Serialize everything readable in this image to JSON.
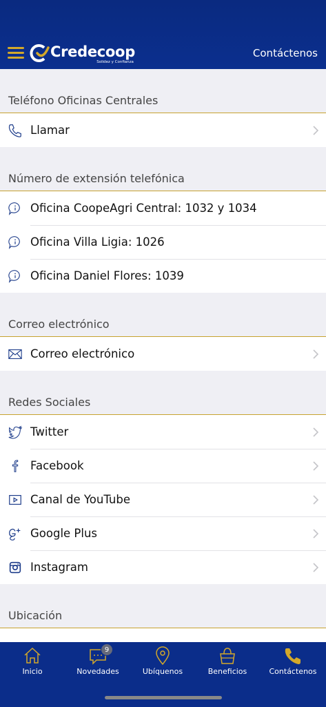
{
  "header": {
    "brand_name": "Credecoop",
    "brand_tagline": "Solidez y Confianza",
    "action_label": "Contáctenos"
  },
  "sections": [
    {
      "title": "Teléfono Oficinas Centrales",
      "rows": [
        {
          "icon": "phone-icon",
          "label": "Llamar",
          "chevron": true
        }
      ]
    },
    {
      "title": "Número de extensión telefónica",
      "rows": [
        {
          "icon": "info-icon",
          "label": "Oficina CoopeAgri Central: 1032 y 1034",
          "chevron": false
        },
        {
          "icon": "info-icon",
          "label": "Oficina Villa Ligia: 1026",
          "chevron": false
        },
        {
          "icon": "info-icon",
          "label": "Oficina Daniel Flores: 1039",
          "chevron": false
        }
      ]
    },
    {
      "title": "Correo electrónico",
      "rows": [
        {
          "icon": "mail-icon",
          "label": "Correo electrónico",
          "chevron": true
        }
      ]
    },
    {
      "title": "Redes Sociales",
      "rows": [
        {
          "icon": "twitter-icon",
          "label": "Twitter",
          "chevron": true
        },
        {
          "icon": "facebook-icon",
          "label": "Facebook",
          "chevron": true
        },
        {
          "icon": "youtube-icon",
          "label": "Canal de YouTube",
          "chevron": true
        },
        {
          "icon": "google-plus-icon",
          "label": "Google Plus",
          "chevron": true
        },
        {
          "icon": "instagram-icon",
          "label": "Instagram",
          "chevron": true
        }
      ]
    },
    {
      "title": "Ubicación",
      "rows": []
    }
  ],
  "tabbar": {
    "tabs": [
      {
        "label": "Inicio",
        "icon": "home-icon"
      },
      {
        "label": "Novedades",
        "icon": "chat-icon",
        "badge": "9"
      },
      {
        "label": "Ubíquenos",
        "icon": "location-pin-icon"
      },
      {
        "label": "Beneficios",
        "icon": "shopping-bag-icon"
      },
      {
        "label": "Contáctenos",
        "icon": "phone-icon",
        "active": true
      }
    ]
  },
  "colors": {
    "brand_blue": "#0b2d8a",
    "accent_gold": "#d3a82a",
    "icon_blue": "#1d3c8a"
  }
}
